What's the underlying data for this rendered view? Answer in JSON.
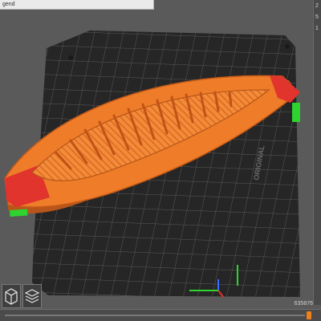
{
  "legend": {
    "label": "gend"
  },
  "right_slider": {
    "top_label": "2",
    "mid_label": "5",
    "low_label": "1"
  },
  "layer_count": "635876",
  "bed": {
    "brand_text": "ORIGINAL"
  },
  "colors": {
    "background": "#5a5a5a",
    "bed": "#262626",
    "grid": "#5a5a5a",
    "perimeter": "#d94a1a",
    "infill": "#f07a20",
    "skirt_green": "#2fd32f",
    "slider_thumb": "#f0801a"
  },
  "icons": [
    "iso-view-icon",
    "layers-view-icon",
    "axis-gizmo-icon"
  ]
}
